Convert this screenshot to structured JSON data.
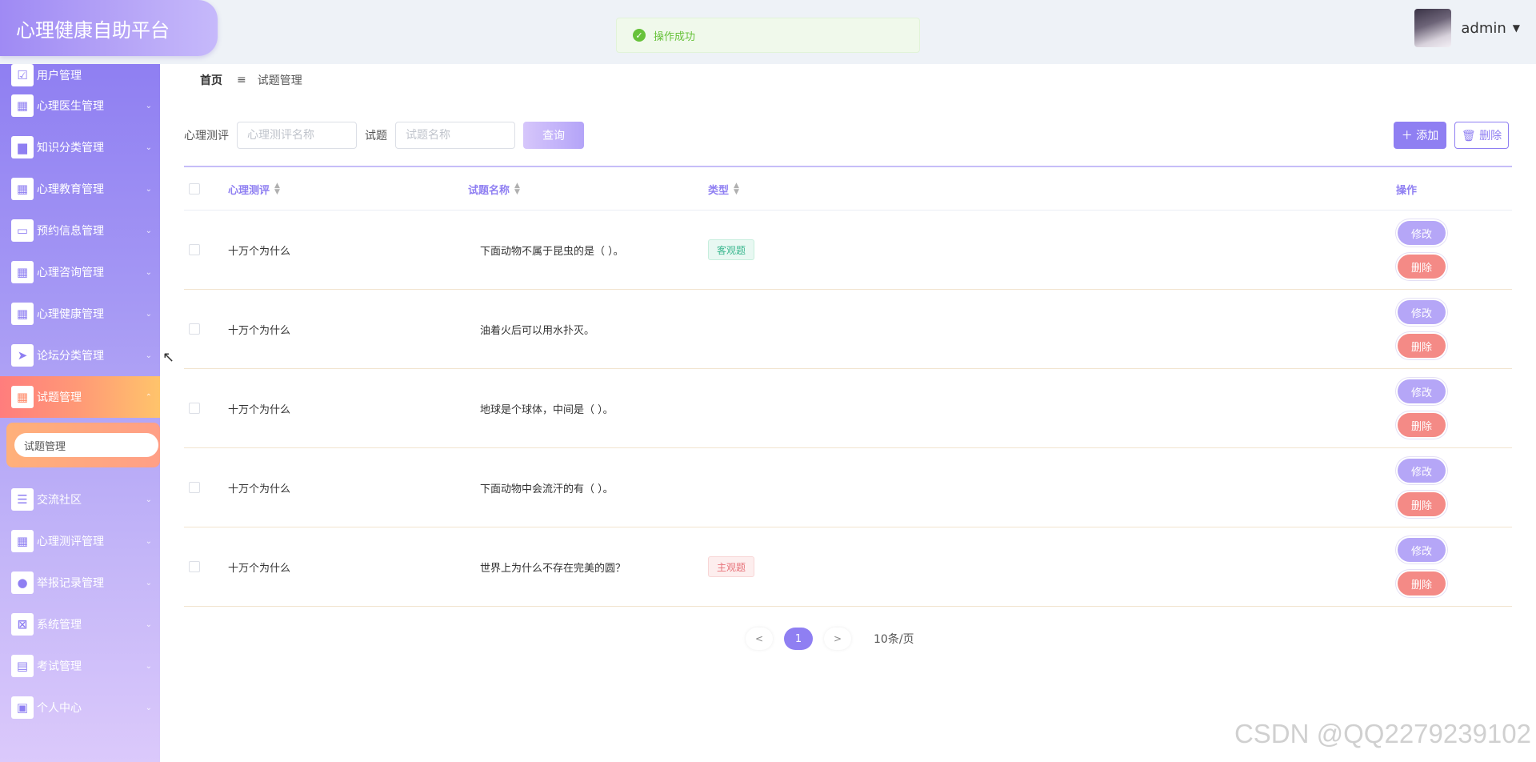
{
  "app": {
    "title": "心理健康自助平台"
  },
  "toast": {
    "message": "操作成功"
  },
  "user": {
    "name": "admin"
  },
  "sidebar": {
    "items": [
      {
        "label": "用户管理",
        "icon": "check-square-icon"
      },
      {
        "label": "心理医生管理",
        "icon": "grid-icon"
      },
      {
        "label": "知识分类管理",
        "icon": "sign-icon"
      },
      {
        "label": "心理教育管理",
        "icon": "grid-icon"
      },
      {
        "label": "预约信息管理",
        "icon": "monitor-icon"
      },
      {
        "label": "心理咨询管理",
        "icon": "grid-icon"
      },
      {
        "label": "心理健康管理",
        "icon": "grid-icon"
      },
      {
        "label": "论坛分类管理",
        "icon": "send-icon"
      },
      {
        "label": "试题管理",
        "icon": "grid-icon",
        "active": true
      },
      {
        "label": "交流社区",
        "icon": "list-icon"
      },
      {
        "label": "心理测评管理",
        "icon": "grid-icon"
      },
      {
        "label": "举报记录管理",
        "icon": "user-icon"
      },
      {
        "label": "系统管理",
        "icon": "clipboard-x-icon"
      },
      {
        "label": "考试管理",
        "icon": "clipboard-icon"
      },
      {
        "label": "个人中心",
        "icon": "card-icon"
      }
    ],
    "submenu": {
      "label": "试题管理"
    }
  },
  "breadcrumb": {
    "home": "首页",
    "current": "试题管理"
  },
  "search": {
    "field1_label": "心理测评",
    "field1_placeholder": "心理测评名称",
    "field2_label": "试题",
    "field2_placeholder": "试题名称",
    "query_label": "查询"
  },
  "toolbar": {
    "add_label": "添加",
    "delete_label": "删除"
  },
  "table": {
    "headers": {
      "assessment": "心理测评",
      "question": "试题名称",
      "type": "类型",
      "actions": "操作"
    },
    "rows": [
      {
        "assessment": "十万个为什么",
        "question": "下面动物不属于昆虫的是（ ）。",
        "type": "客观题",
        "type_kind": "obj"
      },
      {
        "assessment": "十万个为什么",
        "question": "油着火后可以用水扑灭。",
        "type": "",
        "type_kind": ""
      },
      {
        "assessment": "十万个为什么",
        "question": "地球是个球体，中间是（ ）。",
        "type": "",
        "type_kind": ""
      },
      {
        "assessment": "十万个为什么",
        "question": "下面动物中会流汗的有（ ）。",
        "type": "",
        "type_kind": ""
      },
      {
        "assessment": "十万个为什么",
        "question": "世界上为什么不存在完美的圆？",
        "type": "主观题",
        "type_kind": "subj"
      }
    ],
    "edit_label": "修改",
    "delete_label": "删除"
  },
  "pagination": {
    "prev": "<",
    "current": "1",
    "next": ">",
    "page_size": "10条/页"
  },
  "watermark": "CSDN @QQ2279239102",
  "colors": {
    "accent": "#8f7ff2",
    "success": "#67c23a",
    "danger": "#f48a86"
  }
}
